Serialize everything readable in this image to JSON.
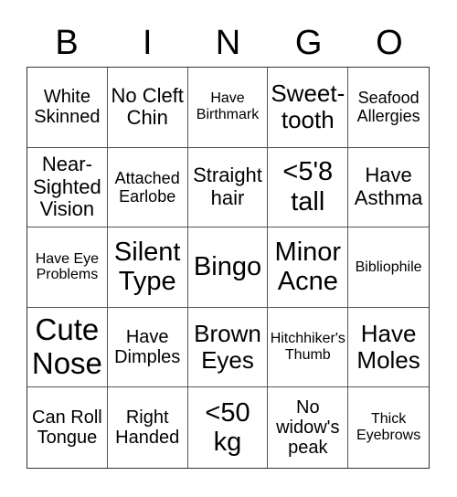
{
  "header": [
    "B",
    "I",
    "N",
    "G",
    "O"
  ],
  "cells": [
    {
      "text": "White Skinned",
      "size": "s3"
    },
    {
      "text": "No Cleft Chin",
      "size": "s4"
    },
    {
      "text": "Have Birthmark",
      "size": "s1"
    },
    {
      "text": "Sweet-tooth",
      "size": "s5"
    },
    {
      "text": "Seafood Allergies",
      "size": "s2"
    },
    {
      "text": "Near-Sighted Vision",
      "size": "s4"
    },
    {
      "text": "Attached Earlobe",
      "size": "s2"
    },
    {
      "text": "Straight hair",
      "size": "s4"
    },
    {
      "text": "<5'8 tall",
      "size": "s6"
    },
    {
      "text": "Have Asthma",
      "size": "s4"
    },
    {
      "text": "Have Eye Problems",
      "size": "s1"
    },
    {
      "text": "Silent Type",
      "size": "s6"
    },
    {
      "text": "Bingo",
      "size": "s6"
    },
    {
      "text": "Minor Acne",
      "size": "s6"
    },
    {
      "text": "Bibliophile",
      "size": "s1"
    },
    {
      "text": "Cute Nose",
      "size": "s7"
    },
    {
      "text": "Have Dimples",
      "size": "s3"
    },
    {
      "text": "Brown Eyes",
      "size": "s5"
    },
    {
      "text": "Hitchhiker's Thumb",
      "size": "s1"
    },
    {
      "text": "Have Moles",
      "size": "s5"
    },
    {
      "text": "Can Roll Tongue",
      "size": "s3"
    },
    {
      "text": "Right Handed",
      "size": "s3"
    },
    {
      "text": "<50 kg",
      "size": "s6"
    },
    {
      "text": "No widow's peak",
      "size": "s3"
    },
    {
      "text": "Thick Eyebrows",
      "size": "s1"
    }
  ]
}
